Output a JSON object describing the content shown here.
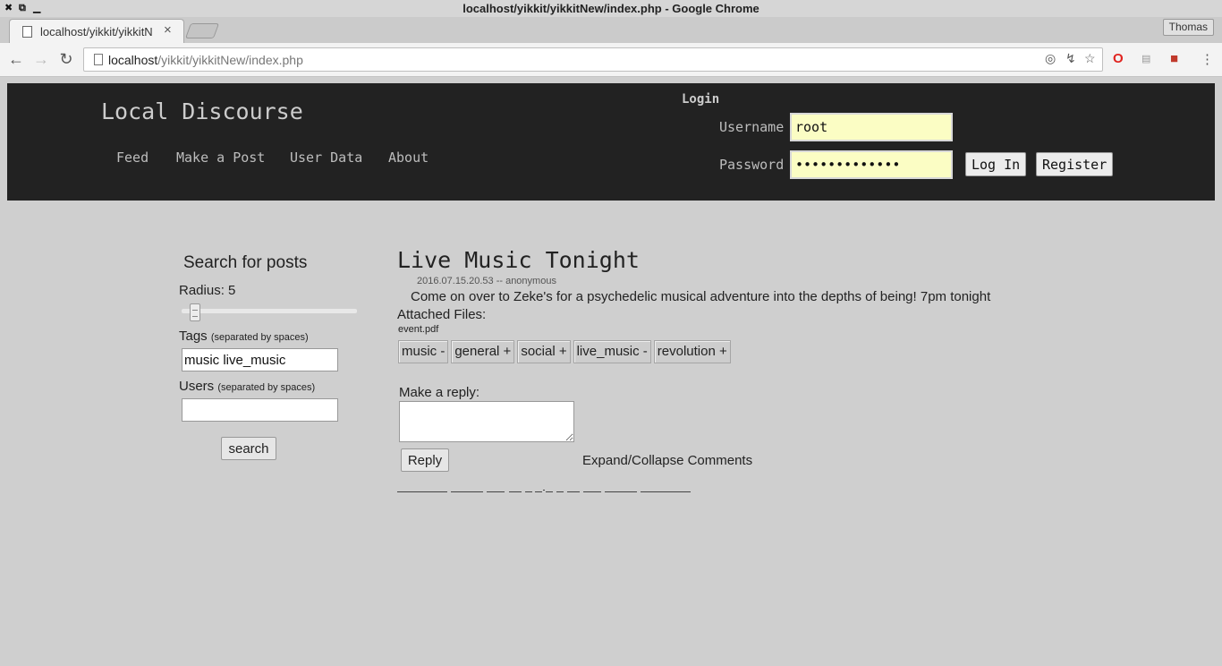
{
  "browser": {
    "window_title": "localhost/yikkit/yikkitNew/index.php - Google Chrome",
    "tab_title": "localhost/yikkit/yikkitN",
    "tab_close": "×",
    "profile_name": "Thomas",
    "url_host": "localhost",
    "url_path": "/yikkit/yikkitNew/index.php",
    "wm_buttons": [
      "✖",
      "⧉",
      "▁"
    ],
    "nav_icons": [
      "arrow-left-icon",
      "arrow-right-icon",
      "reload-icon"
    ],
    "omnibox_icons": [
      "location-icon",
      "key-icon",
      "star-icon"
    ],
    "extension_icons": [
      "opera-icon",
      "extension-icon",
      "bookmark-icon",
      "menu-icon"
    ]
  },
  "site": {
    "title": "Local Discourse",
    "nav": [
      "Feed",
      "Make a Post",
      "User Data",
      "About"
    ],
    "login": {
      "heading": "Login",
      "username_label": "Username",
      "username_value": "root",
      "password_label": "Password",
      "password_value": "•••••••••••••",
      "login_button": "Log In",
      "register_button": "Register"
    }
  },
  "sidebar": {
    "heading": "Search for posts",
    "radius_label": "Radius: 5",
    "radius_value": 5,
    "tags_label": "Tags",
    "tags_hint": "(separated by spaces)",
    "tags_value": "music live_music",
    "users_label": "Users",
    "users_hint": "(separated by spaces)",
    "users_value": "",
    "search_button": "search"
  },
  "post": {
    "title": "Live Music Tonight",
    "meta": "2016.07.15.20.53 -- anonymous",
    "body": "Come on over to Zeke's for a psychedelic musical adventure into the depths of being! 7pm tonight",
    "files_label": "Attached Files:",
    "file": "event.pdf",
    "tags": [
      "music -",
      "general +",
      "social +",
      "live_music -",
      "revolution +"
    ],
    "reply_label": "Make a reply:",
    "reply_value": "",
    "reply_button": "Reply",
    "expand_label": "Expand/Collapse Comments"
  },
  "colors": {
    "page_bg": "#cfcfcf",
    "header_bg": "#222222",
    "login_field_bg": "#fbfdc4"
  }
}
